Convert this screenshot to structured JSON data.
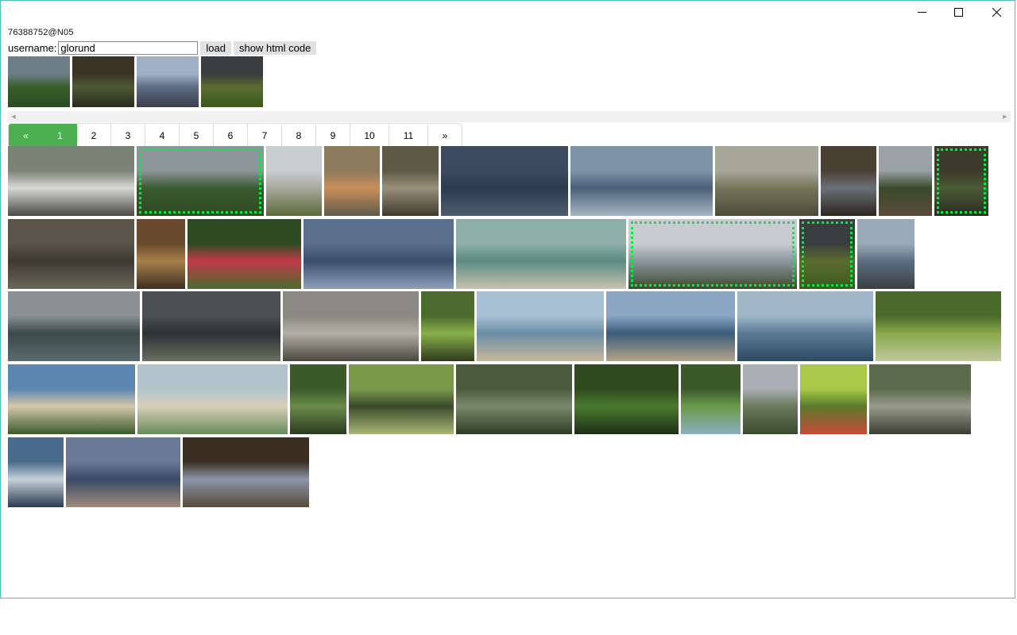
{
  "window": {
    "controls": {
      "minimize": "minimize-icon",
      "maximize": "maximize-icon",
      "close": "close-icon"
    }
  },
  "header": {
    "user_id": "76388752@N05",
    "username_label": "username:",
    "username_value": "glorund",
    "load_label": "load",
    "show_html_label": "show html code"
  },
  "selected_photos": [
    {
      "colors": [
        "#6d7d86",
        "#3b5e2c",
        "#2a4a22"
      ]
    },
    {
      "colors": [
        "#3a3326",
        "#4d5a34",
        "#2b2a1f"
      ]
    },
    {
      "colors": [
        "#9fb0c6",
        "#5f6d85",
        "#3a3e4a"
      ]
    },
    {
      "colors": [
        "#3a3d3f",
        "#5b6c2d",
        "#3b5a1f"
      ]
    }
  ],
  "pagination": {
    "prev": "«",
    "next": "»",
    "pages": [
      "1",
      "2",
      "3",
      "4",
      "5",
      "6",
      "7",
      "8",
      "9",
      "10",
      "11"
    ],
    "active": "1"
  },
  "gallery": [
    [
      {
        "colors": [
          "#7b8276",
          "#d8d9d4",
          "#4a4a42"
        ],
        "selected": false
      },
      {
        "colors": [
          "#8d969a",
          "#3c5a30",
          "#2e4a24"
        ],
        "selected": true
      },
      {
        "colors": [
          "#c8cdd0",
          "#a8a89c",
          "#5a6a3a"
        ],
        "selected": false
      },
      {
        "colors": [
          "#8b7a5c",
          "#c98f5a",
          "#5e5a4a"
        ],
        "selected": false
      },
      {
        "colors": [
          "#5c5a45",
          "#9a8f7a",
          "#3d3a2e"
        ],
        "selected": false
      },
      {
        "colors": [
          "#3b4a5e",
          "#2c3a4e",
          "#4e5c70"
        ],
        "selected": false
      },
      {
        "colors": [
          "#7d93a8",
          "#4a6078",
          "#a9b6c2"
        ],
        "selected": false
      },
      {
        "colors": [
          "#a8a89a",
          "#75755c",
          "#4c4b3a"
        ],
        "selected": false
      },
      {
        "colors": [
          "#4a3f33",
          "#6b6f77",
          "#2b2721"
        ],
        "selected": false
      },
      {
        "colors": [
          "#9aa2a6",
          "#3a4a2c",
          "#5a4b3a"
        ],
        "selected": false
      },
      {
        "colors": [
          "#3b3a2c",
          "#4c5a36",
          "#2a2a22"
        ],
        "selected": true
      }
    ],
    [
      {
        "colors": [
          "#5a544a",
          "#3d3a33",
          "#6a6658"
        ],
        "selected": false
      },
      {
        "colors": [
          "#6a4a2e",
          "#a8804a",
          "#3b2e22"
        ],
        "selected": false
      },
      {
        "colors": [
          "#2e4a22",
          "#c23a4a",
          "#486c2e"
        ],
        "selected": false
      },
      {
        "colors": [
          "#5a6f8c",
          "#3a4e6c",
          "#8ea0b8"
        ],
        "selected": false
      },
      {
        "colors": [
          "#8fb0a8",
          "#5a8a80",
          "#c8c2b0"
        ],
        "selected": false
      },
      {
        "colors": [
          "#c8ccd0",
          "#8b96a0",
          "#3c4a2a"
        ],
        "selected": true
      },
      {
        "colors": [
          "#3a3d3f",
          "#5b6c2d",
          "#3b5a1f"
        ],
        "selected": true
      },
      {
        "colors": [
          "#9aaab8",
          "#5c6e80",
          "#3a3e44"
        ],
        "selected": false
      }
    ],
    [
      {
        "colors": [
          "#8a8f92",
          "#3c4a48",
          "#5a6a6c"
        ],
        "selected": false
      },
      {
        "colors": [
          "#4a4f52",
          "#2c3234",
          "#6b6e60"
        ],
        "selected": false
      },
      {
        "colors": [
          "#8a8a82",
          "#b2b0a4",
          "#4a4640"
        ],
        "selected": false
      },
      {
        "colors": [
          "#4a6a2e",
          "#8ab04a",
          "#2e3a1e"
        ],
        "selected": false
      },
      {
        "colors": [
          "#a8c0d4",
          "#6a8ea6",
          "#c8b89a"
        ],
        "selected": false
      },
      {
        "colors": [
          "#8aa6c4",
          "#3a5a7a",
          "#b4a48a"
        ],
        "selected": false
      },
      {
        "colors": [
          "#9fb6c8",
          "#5a7a94",
          "#2e4a62"
        ],
        "selected": false
      },
      {
        "colors": [
          "#4a6a2a",
          "#8aa84a",
          "#c0c8a0"
        ],
        "selected": false
      }
    ],
    [
      {
        "colors": [
          "#5a86b0",
          "#d4c8aa",
          "#3a5a2a"
        ],
        "selected": false
      },
      {
        "colors": [
          "#b4c4cc",
          "#d8d0b8",
          "#6a8a5a"
        ],
        "selected": false
      },
      {
        "colors": [
          "#3a5a2a",
          "#6a8a4a",
          "#2a3a1e"
        ],
        "selected": false
      },
      {
        "colors": [
          "#7a9a4a",
          "#3a4a2a",
          "#a8b878"
        ],
        "selected": false
      },
      {
        "colors": [
          "#4a5a3a",
          "#7a8a6a",
          "#2e3a22"
        ],
        "selected": false
      },
      {
        "colors": [
          "#2e4a1e",
          "#4a7a2e",
          "#1e2e16"
        ],
        "selected": false
      },
      {
        "colors": [
          "#3a5a2a",
          "#6a9a4a",
          "#8ab0c0"
        ],
        "selected": false
      },
      {
        "colors": [
          "#a8aeb4",
          "#6a7a5a",
          "#3a4a2e"
        ],
        "selected": false
      },
      {
        "colors": [
          "#a8c84a",
          "#5a7a2a",
          "#c84a3a"
        ],
        "selected": false
      },
      {
        "colors": [
          "#5a6a4a",
          "#9a9a8c",
          "#3a3e32"
        ],
        "selected": false
      }
    ],
    [
      {
        "colors": [
          "#4a6a8c",
          "#c8d0d8",
          "#2a3a4e"
        ],
        "selected": false
      },
      {
        "colors": [
          "#6a7a96",
          "#3a4a66",
          "#a08a7a"
        ],
        "selected": false
      },
      {
        "colors": [
          "#3a2e22",
          "#8a96a8",
          "#5a4a3a"
        ],
        "selected": false
      }
    ]
  ]
}
